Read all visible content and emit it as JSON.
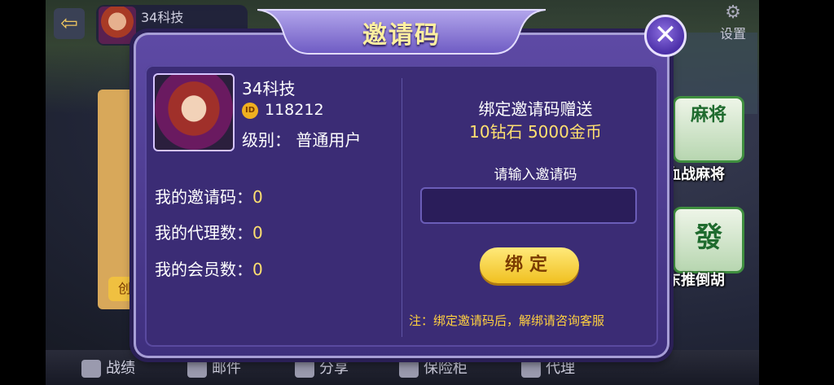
{
  "background": {
    "top_user": {
      "name": "34科技"
    },
    "settings_label": "设置",
    "left_button": "创",
    "game_tiles": [
      {
        "glyph": "麻将",
        "label": "血战麻将"
      },
      {
        "glyph": "發",
        "label": "东推倒胡"
      }
    ],
    "bottom_nav": [
      {
        "label": "战绩",
        "icon": "trophy-icon"
      },
      {
        "label": "邮件",
        "icon": "mail-icon"
      },
      {
        "label": "分享",
        "icon": "share-icon"
      },
      {
        "label": "保险柜",
        "icon": "safe-icon"
      },
      {
        "label": "代理",
        "icon": "agent-icon"
      }
    ]
  },
  "dialog": {
    "title": "邀请码",
    "close_icon": "close-icon",
    "user": {
      "name": "34科技",
      "id_badge": "ID",
      "id": "118212",
      "level": "级别：  普通用户"
    },
    "stats": [
      {
        "label": "我的邀请码：",
        "value": "0"
      },
      {
        "label": "我的代理数：",
        "value": "0"
      },
      {
        "label": "我的会员数：",
        "value": "0"
      }
    ],
    "bind": {
      "title": "绑定邀请码赠送",
      "reward": "10钻石 5000金币",
      "prompt": "请输入邀请码",
      "input_value": "",
      "input_placeholder": "",
      "button": "绑定",
      "note": "注：绑定邀请码后，解绑请咨询客服"
    }
  }
}
